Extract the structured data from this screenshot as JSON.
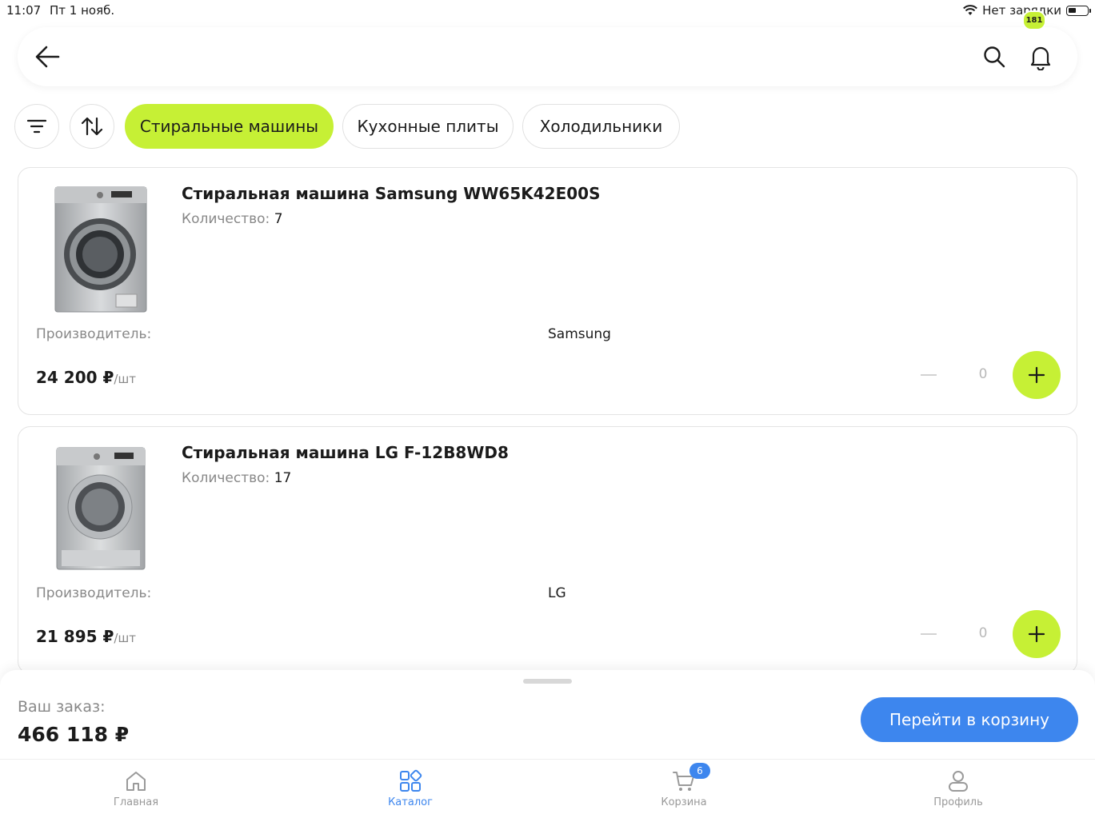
{
  "status_bar": {
    "time": "11:07",
    "date": "Пт 1 нояб.",
    "charging": "Нет зарядки"
  },
  "header": {
    "notifications_count": "181"
  },
  "filters": {
    "chips": [
      {
        "label": "Стиральные машины",
        "active": true
      },
      {
        "label": "Кухонные плиты",
        "active": false
      },
      {
        "label": "Холодильники",
        "active": false
      }
    ]
  },
  "products": [
    {
      "title": "Стиральная машина Samsung WW65K42E00S",
      "qty_label": "Количество:",
      "qty_value": "7",
      "maker_label": "Производитель:",
      "maker_value": "Samsung",
      "price": "24 200 ₽",
      "price_unit": "/шт",
      "count": "0"
    },
    {
      "title": "Стиральная машина LG F-12B8WD8",
      "qty_label": "Количество:",
      "qty_value": "17",
      "maker_label": "Производитель:",
      "maker_value": "LG",
      "price": "21 895 ₽",
      "price_unit": "/шт",
      "count": "0"
    }
  ],
  "order": {
    "label": "Ваш заказ:",
    "total": "466 118 ₽",
    "go_to_cart": "Перейти в корзину"
  },
  "tabbar": {
    "items": [
      {
        "label": "Главная",
        "icon": "home-icon"
      },
      {
        "label": "Каталог",
        "icon": "catalog-icon"
      },
      {
        "label": "Корзина",
        "icon": "cart-icon"
      },
      {
        "label": "Профиль",
        "icon": "profile-icon"
      }
    ],
    "cart_badge": "6"
  },
  "colors": {
    "accent_green": "#c6f035",
    "accent_blue": "#3d86ee"
  }
}
